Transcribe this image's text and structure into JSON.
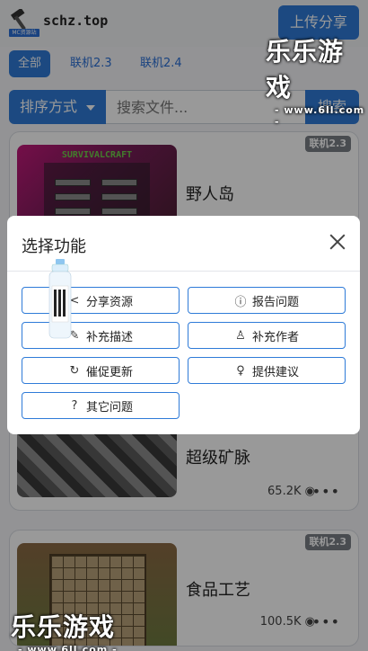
{
  "header": {
    "site_name": "schz.top",
    "logo_tag": "MC资源站",
    "upload_label": "上传分享"
  },
  "filters": {
    "tabs": [
      {
        "label": "全部",
        "active": true
      },
      {
        "label": "联机2.3",
        "active": false
      },
      {
        "label": "联机2.4",
        "active": false
      }
    ]
  },
  "search": {
    "sort_label": "排序方式",
    "placeholder": "搜索文件...",
    "button_label": "搜索"
  },
  "cards": [
    {
      "title": "野人岛",
      "badge": "联机2.3",
      "thumb_title": "SURVIVALCRAFT"
    },
    {
      "title": "超级矿脉",
      "views": "65.2K",
      "more": "•••"
    },
    {
      "title": "食品工艺",
      "badge": "联机2.3",
      "views": "100.5K",
      "more": "•••"
    }
  ],
  "modal": {
    "title": "选择功能",
    "options": [
      {
        "label": "分享资源",
        "icon": "share-icon"
      },
      {
        "label": "报告问题",
        "icon": "alert-icon"
      },
      {
        "label": "补充描述",
        "icon": "edit-icon"
      },
      {
        "label": "补充作者",
        "icon": "user-plus-icon"
      },
      {
        "label": "催促更新",
        "icon": "refresh-icon"
      },
      {
        "label": "提供建议",
        "icon": "lightbulb-icon"
      },
      {
        "label": "其它问题",
        "icon": "question-icon"
      }
    ]
  },
  "watermark": {
    "brand": "乐乐游戏",
    "url": "- www.6ll.com -"
  }
}
